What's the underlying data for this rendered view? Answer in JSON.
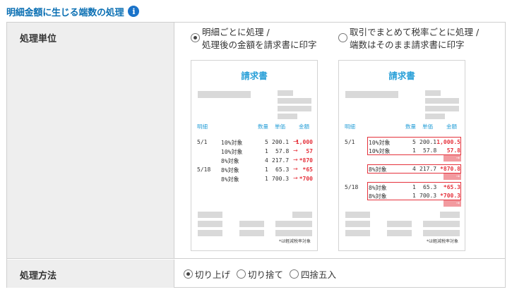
{
  "header": {
    "title": "明細金額に生じる端数の処理",
    "info_icon": "info-icon",
    "info_glyph": "i"
  },
  "row_unit": {
    "label": "処理単位",
    "option_a": {
      "line1": "明細ごとに処理 /",
      "line2": "処理後の金額を請求書に印字",
      "selected": true
    },
    "option_b": {
      "line1": "取引でまとめて税率ごとに処理 /",
      "line2": "端数はそのまま請求書に印字",
      "selected": false
    }
  },
  "invoice": {
    "title": "請求書",
    "cols": {
      "item": "明細",
      "qty": "数量",
      "price": "単価",
      "amount": "金額"
    },
    "note": "*は軽減税率対象",
    "a_rows": [
      {
        "date": "5/1",
        "item": "10%対象",
        "qty": "5",
        "price": "200.1",
        "amount": "1,000"
      },
      {
        "date": "",
        "item": "10%対象",
        "qty": "1",
        "price": "57.8",
        "amount": "57"
      },
      {
        "date": "",
        "item": "8%対象",
        "qty": "4",
        "price": "217.7",
        "amount": "*870"
      },
      {
        "date": "5/18",
        "item": "8%対象",
        "qty": "1",
        "price": "65.3",
        "amount": "*65"
      },
      {
        "date": "",
        "item": "8%対象",
        "qty": "1",
        "price": "700.3",
        "amount": "*700"
      }
    ],
    "b_rows": [
      {
        "date": "5/1",
        "item": "10%対象",
        "qty": "5",
        "price": "200.1",
        "amount": "1,000.5"
      },
      {
        "date": "",
        "item": "10%対象",
        "qty": "1",
        "price": "57.8",
        "amount": "57.8"
      },
      {
        "date": "",
        "item": "8%対象",
        "qty": "4",
        "price": "217.7",
        "amount": "*870.8"
      },
      {
        "date": "5/18",
        "item": "8%対象",
        "qty": "1",
        "price": "65.3",
        "amount": "*65.3"
      },
      {
        "date": "",
        "item": "8%対象",
        "qty": "1",
        "price": "700.3",
        "amount": "*700.3"
      }
    ],
    "b_tags": {
      "t1": "→ 1,058",
      "t2": "→ *870",
      "t3": "→ *765"
    },
    "arrow": "→"
  },
  "row_method": {
    "label": "処理方法",
    "options": [
      {
        "label": "切り上げ",
        "selected": true
      },
      {
        "label": "切り捨て",
        "selected": false
      },
      {
        "label": "四捨五入",
        "selected": false
      }
    ]
  },
  "colors": {
    "accent": "#1a73c9",
    "invoice_blue": "#2aa0d8",
    "red": "#e5323c"
  }
}
